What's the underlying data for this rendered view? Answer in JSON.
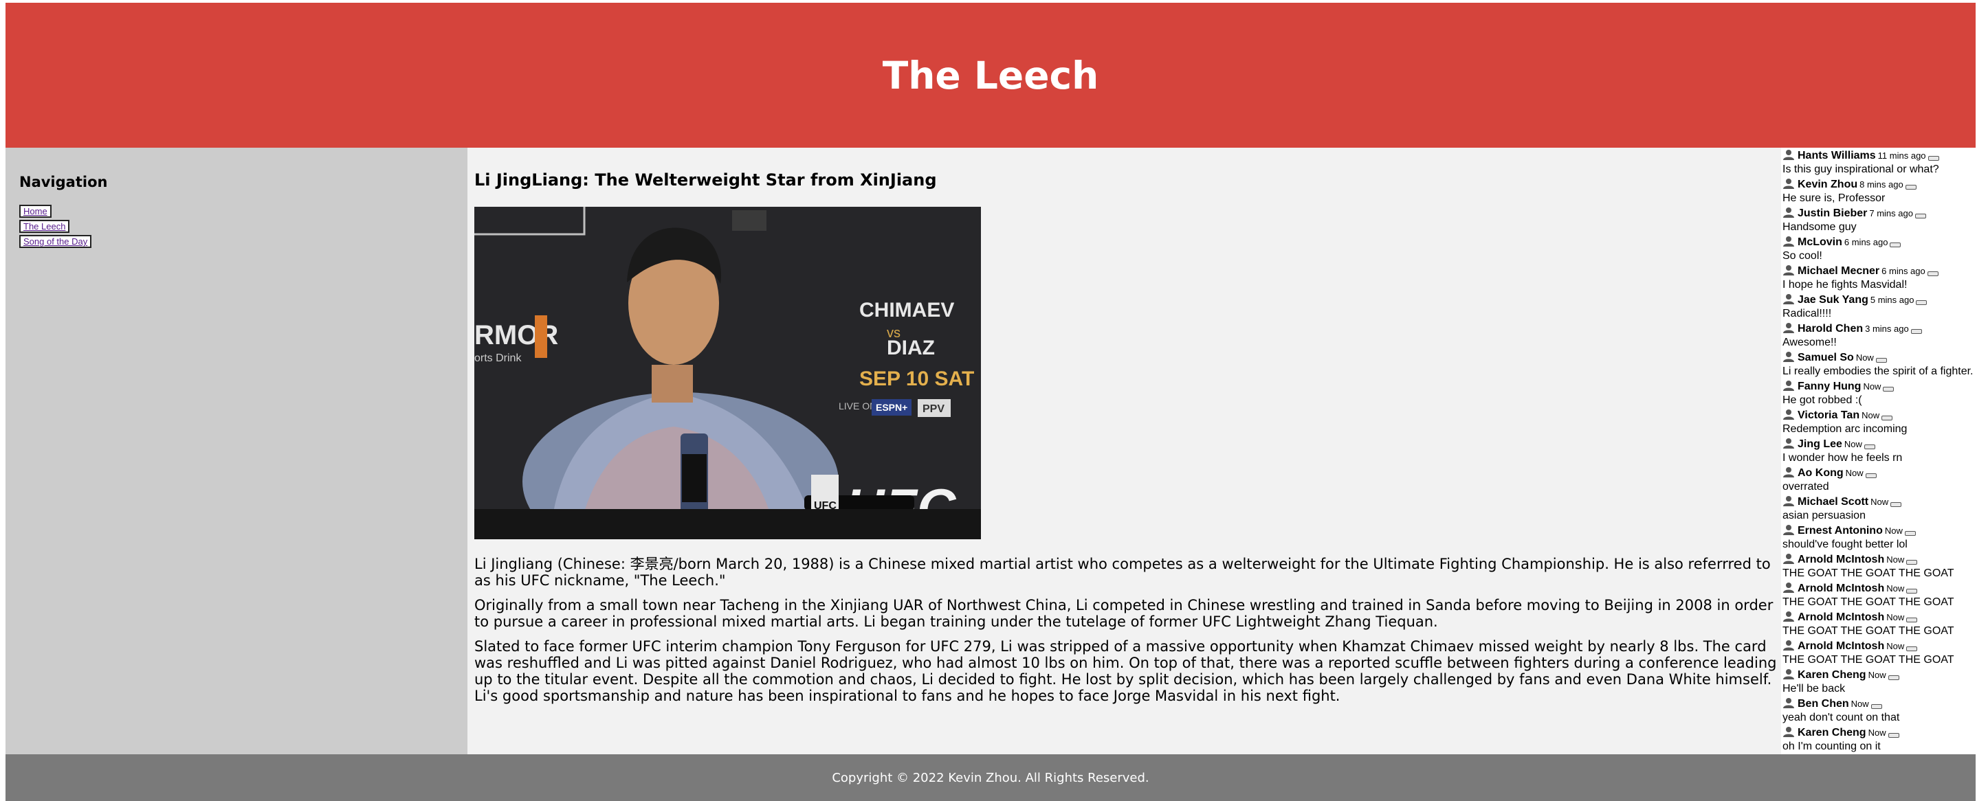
{
  "header": {
    "title": "The Leech"
  },
  "sidebar": {
    "heading": "Navigation",
    "links": [
      "Home",
      "The Leech",
      "Song of the Day"
    ]
  },
  "article": {
    "title": "Li JingLiang: The Welterweight Star from XinJiang",
    "photo": {
      "backdrop_text_left": "RMOR",
      "backdrop_text_left_sub": "orts Drink",
      "backdrop_event": "CHIMAEV",
      "backdrop_vs": "vs",
      "backdrop_event2": "DIAZ",
      "backdrop_date": "SEP 10 SAT",
      "backdrop_live": "LIVE ON",
      "backdrop_espn": "ESPN+",
      "backdrop_ppv": "PPV",
      "backdrop_ufc": "UFC",
      "mic_ufc": "UFC"
    },
    "paragraphs": [
      "Li Jingliang (Chinese: 李景亮/born March 20, 1988) is a Chinese mixed martial artist who competes as a welterweight for the Ultimate Fighting Championship. He is also referrred to as his UFC nickname, \"The Leech.\"",
      "Originally from a small town near Tacheng in the Xinjiang UAR of Northwest China, Li competed in Chinese wrestling and trained in Sanda before moving to Beijing in 2008 in order to pursue a career in professional mixed martial arts. Li began training under the tutelage of former UFC Lightweight Zhang Tiequan.",
      "Slated to face former UFC interim champion Tony Ferguson for UFC 279, Li was stripped of a massive opportunity when Khamzat Chimaev missed weight by nearly 8 lbs. The card was reshuffled and Li was pitted against Daniel Rodriguez, who had almost 10 lbs on him. On top of that, there was a reported scuffle between fighters during a conference leading up to the titular event. Despite all the commotion and chaos, Li decided to fight. He lost by split decision, which has been largely challenged by fans and even Dana White himself. Li's good sportsmanship and nature has been inspirational to fans and he hopes to face Jorge Masvidal in his next fight."
    ]
  },
  "comments": [
    {
      "name": "Hants Williams",
      "time": "11 mins ago",
      "text": "Is this guy inspirational or what?"
    },
    {
      "name": "Kevin Zhou",
      "time": "8 mins ago",
      "text": "He sure is, Professor"
    },
    {
      "name": "Justin Bieber",
      "time": "7 mins ago",
      "text": "Handsome guy"
    },
    {
      "name": "McLovin",
      "time": "6 mins ago",
      "text": "So cool!"
    },
    {
      "name": "Michael Mecner",
      "time": "6 mins ago",
      "text": "I hope he fights Masvidal!"
    },
    {
      "name": "Jae Suk Yang",
      "time": "5 mins ago",
      "text": "Radical!!!!"
    },
    {
      "name": "Harold Chen",
      "time": "3 mins ago",
      "text": "Awesome!!"
    },
    {
      "name": "Samuel So",
      "time": "Now",
      "text": "Li really embodies the spirit of a fighter."
    },
    {
      "name": "Fanny Hung",
      "time": "Now",
      "text": "He got robbed :("
    },
    {
      "name": "Victoria Tan",
      "time": "Now",
      "text": "Redemption arc incoming"
    },
    {
      "name": "Jing Lee",
      "time": "Now",
      "text": "I wonder how he feels rn"
    },
    {
      "name": "Ao Kong",
      "time": "Now",
      "text": "overrated"
    },
    {
      "name": "Michael Scott",
      "time": "Now",
      "text": "asian persuasion"
    },
    {
      "name": "Ernest Antonino",
      "time": "Now",
      "text": "should've fought better lol"
    },
    {
      "name": "Arnold McIntosh",
      "time": "Now",
      "text": "THE GOAT THE GOAT THE GOAT"
    },
    {
      "name": "Arnold McIntosh",
      "time": "Now",
      "text": "THE GOAT THE GOAT THE GOAT"
    },
    {
      "name": "Arnold McIntosh",
      "time": "Now",
      "text": "THE GOAT THE GOAT THE GOAT"
    },
    {
      "name": "Arnold McIntosh",
      "time": "Now",
      "text": "THE GOAT THE GOAT THE GOAT"
    },
    {
      "name": "Karen Cheng",
      "time": "Now",
      "text": "He'll be back"
    },
    {
      "name": "Ben Chen",
      "time": "Now",
      "text": "yeah don't count on that"
    },
    {
      "name": "Karen Cheng",
      "time": "Now",
      "text": "oh I'm counting on it"
    }
  ],
  "footer": {
    "text": "Copyright © 2022 Kevin Zhou. All Rights Reserved."
  }
}
